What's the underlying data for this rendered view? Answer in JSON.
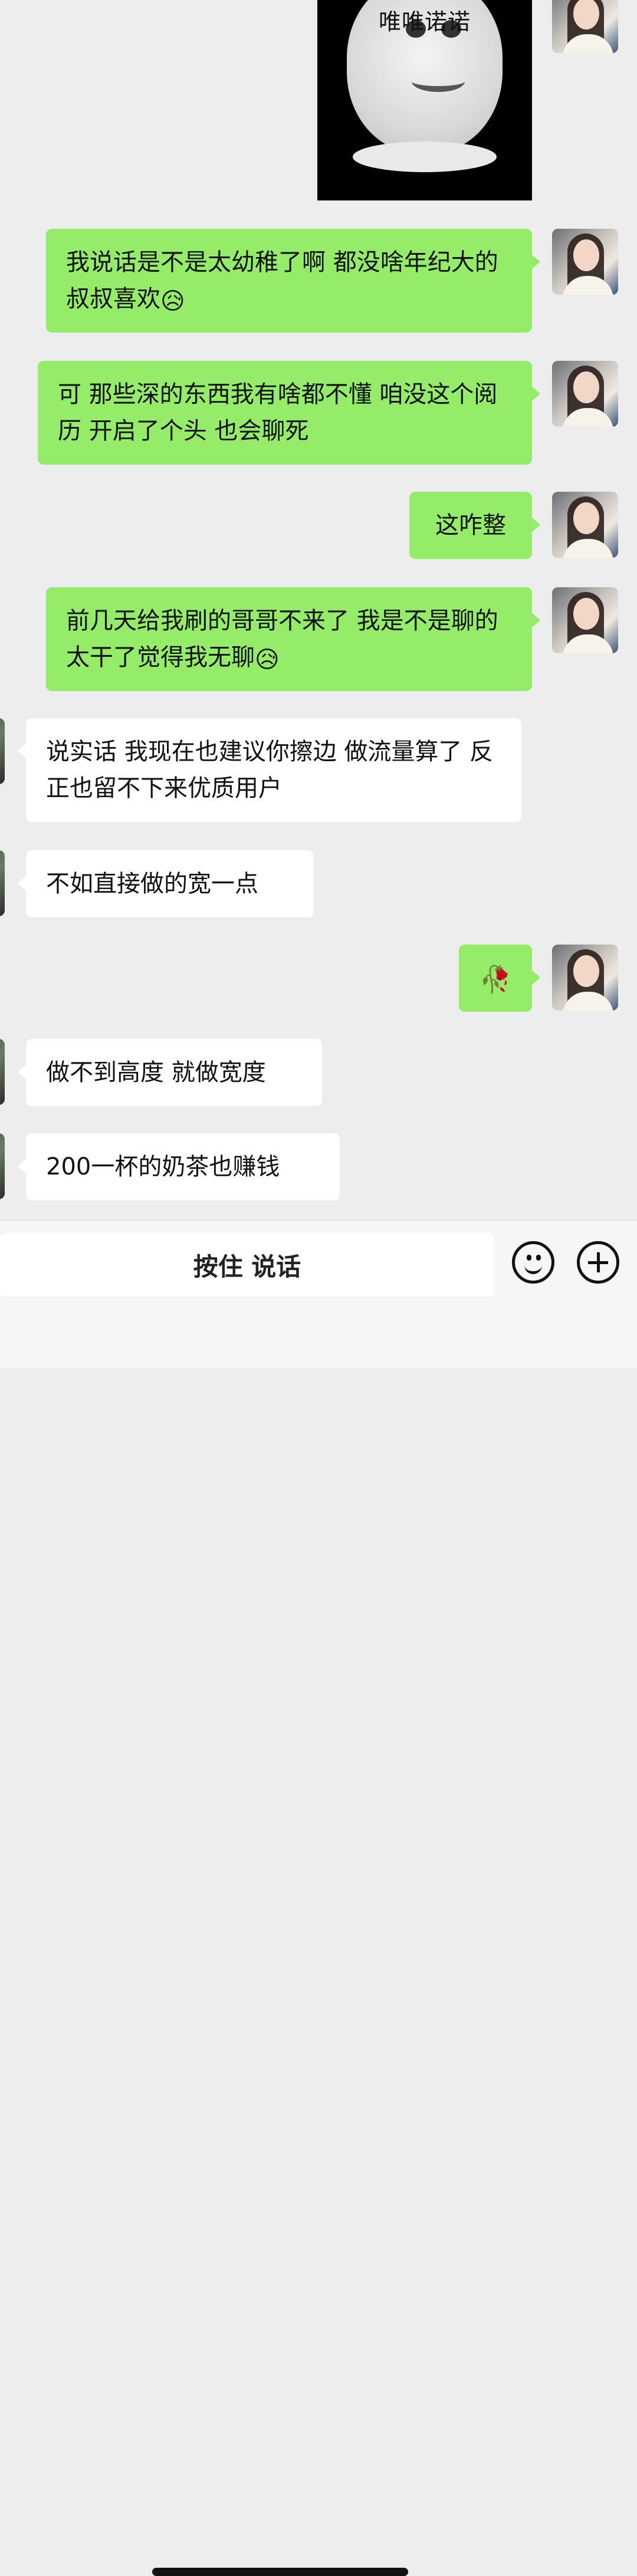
{
  "sticker": {
    "caption": "唯唯诺诺"
  },
  "messages": [
    {
      "side": "me",
      "text": "我说话是不是太幼稚了啊 都没啥年纪大的叔叔喜欢",
      "emoji": "😥"
    },
    {
      "side": "me",
      "text": "可 那些深的东西我有啥都不懂 咱没这个阅历 开启了个头 也会聊死"
    },
    {
      "side": "me",
      "text": "这咋整"
    },
    {
      "side": "me",
      "text": "前几天给我刷的哥哥不来了 我是不是聊的太干了觉得我无聊",
      "emoji": "😥"
    },
    {
      "side": "you",
      "text": "说实话 我现在也建议你擦边 做流量算了 反正也留不下来优质用户"
    },
    {
      "side": "you",
      "text": "不如直接做的宽一点"
    },
    {
      "side": "me",
      "emoji": "🥀"
    },
    {
      "side": "you",
      "text": "做不到高度 就做宽度"
    },
    {
      "side": "you",
      "text": "200一杯的奶茶也赚钱"
    }
  ],
  "input_bar": {
    "hold_to_talk_label": "按住 说话",
    "emoji_icon": "emoji-icon",
    "plus_icon": "plus-icon"
  }
}
